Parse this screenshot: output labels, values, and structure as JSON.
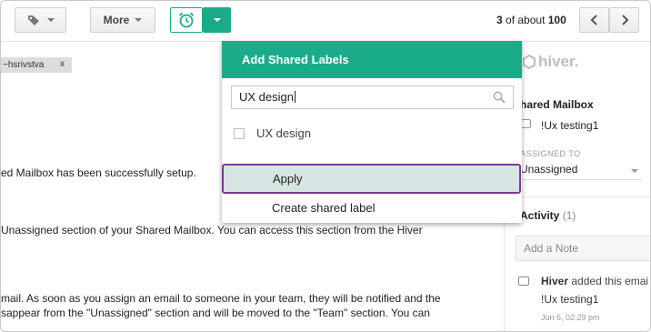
{
  "toolbar": {
    "more_label": "More",
    "pager": {
      "range": "3",
      "of_about": "of about",
      "total": "100"
    }
  },
  "email": {
    "recipient_chip": "~hsrivstva",
    "recipient_remove": "x",
    "lines": [
      "ed Mailbox has been successfully setup.",
      "Unassigned section of your Shared Mailbox. You can access this section from the Hiver",
      "mail. As soon as you assign an email to someone in your team, they will be notified and the",
      "sappear from the \"Unassigned\" section and will be moved to the \"Team\" section. You can"
    ]
  },
  "dropdown": {
    "title": "Add Shared Labels",
    "search_value": "UX design",
    "option_label": "UX design",
    "apply_label": "Apply",
    "create_label": "Create shared label"
  },
  "panel": {
    "brand": "hiver.",
    "title": "hared Mailbox",
    "mailbox_name": "!Ux testing1",
    "assigned_to_label": "ASSIGNED TO",
    "assigned_value": "Unassigned",
    "activity_label": "Activity",
    "activity_count": "(1)",
    "note_placeholder": "Add a Note",
    "activity_actor": "Hiver",
    "activity_action": "added this emai",
    "activity_target": "!Ux testing1",
    "activity_time": "Jun 6, 02:29 pm"
  },
  "colors": {
    "accent": "#1aab8a",
    "apply_highlight": "#d6e5e2",
    "apply_border": "#7b3a93"
  }
}
